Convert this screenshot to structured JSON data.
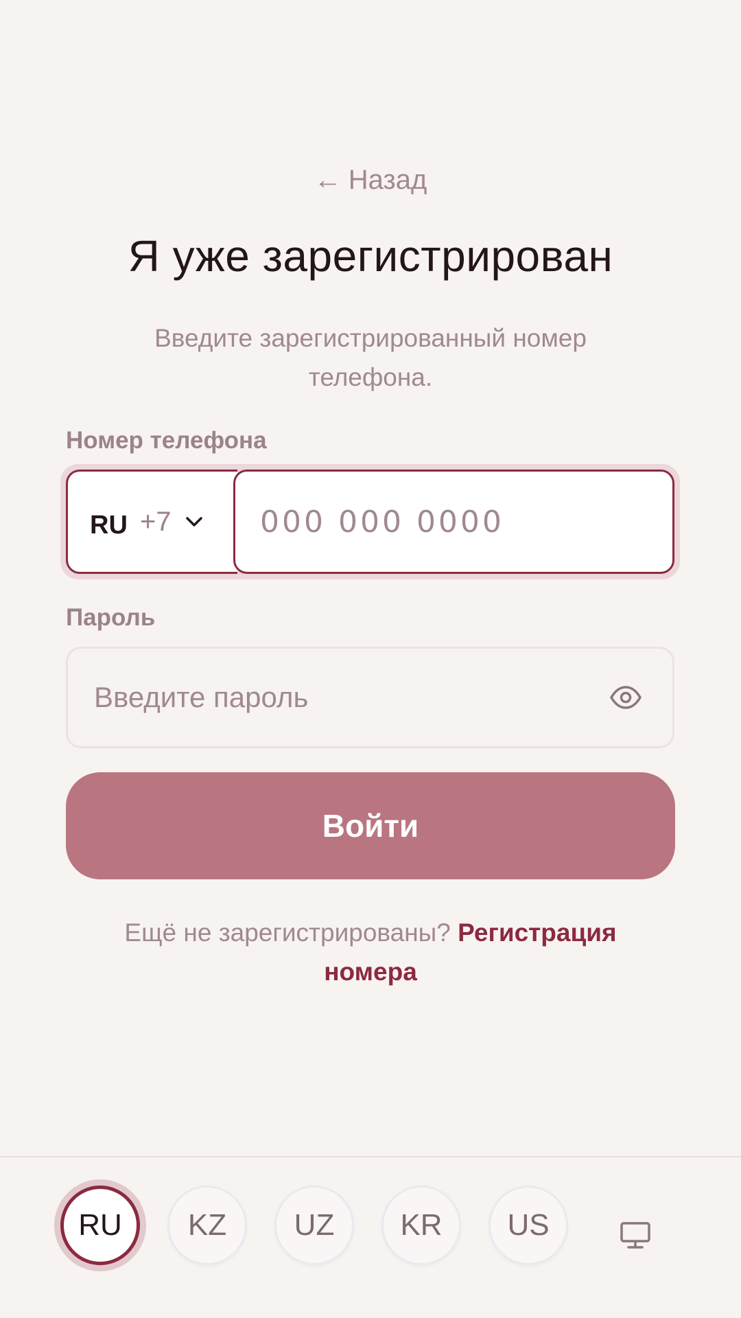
{
  "header": {
    "back_label": "Назад",
    "title": "Я уже зарегистрирован",
    "subtitle": "Введите зарегистрированный номер телефона."
  },
  "phone": {
    "label": "Номер телефона",
    "country": "RU",
    "dial_code": "+7",
    "placeholder": "000 000 0000",
    "value": ""
  },
  "password": {
    "label": "Пароль",
    "placeholder": "Введите пароль",
    "value": ""
  },
  "login_button": "Войти",
  "signup": {
    "prompt": "Ещё не зарегистрированы?",
    "link": "Регистрация номера"
  },
  "languages": {
    "items": [
      "RU",
      "KZ",
      "UZ",
      "KR",
      "US"
    ],
    "active": "RU"
  },
  "icons": {
    "back": "arrow-left-icon",
    "chevron": "chevron-down-icon",
    "eye": "eye-icon",
    "desktop": "monitor-icon"
  },
  "colors": {
    "accent": "#8b2a40",
    "button": "#b97580",
    "background": "#f7f3f1",
    "muted_text": "#a0898f"
  }
}
